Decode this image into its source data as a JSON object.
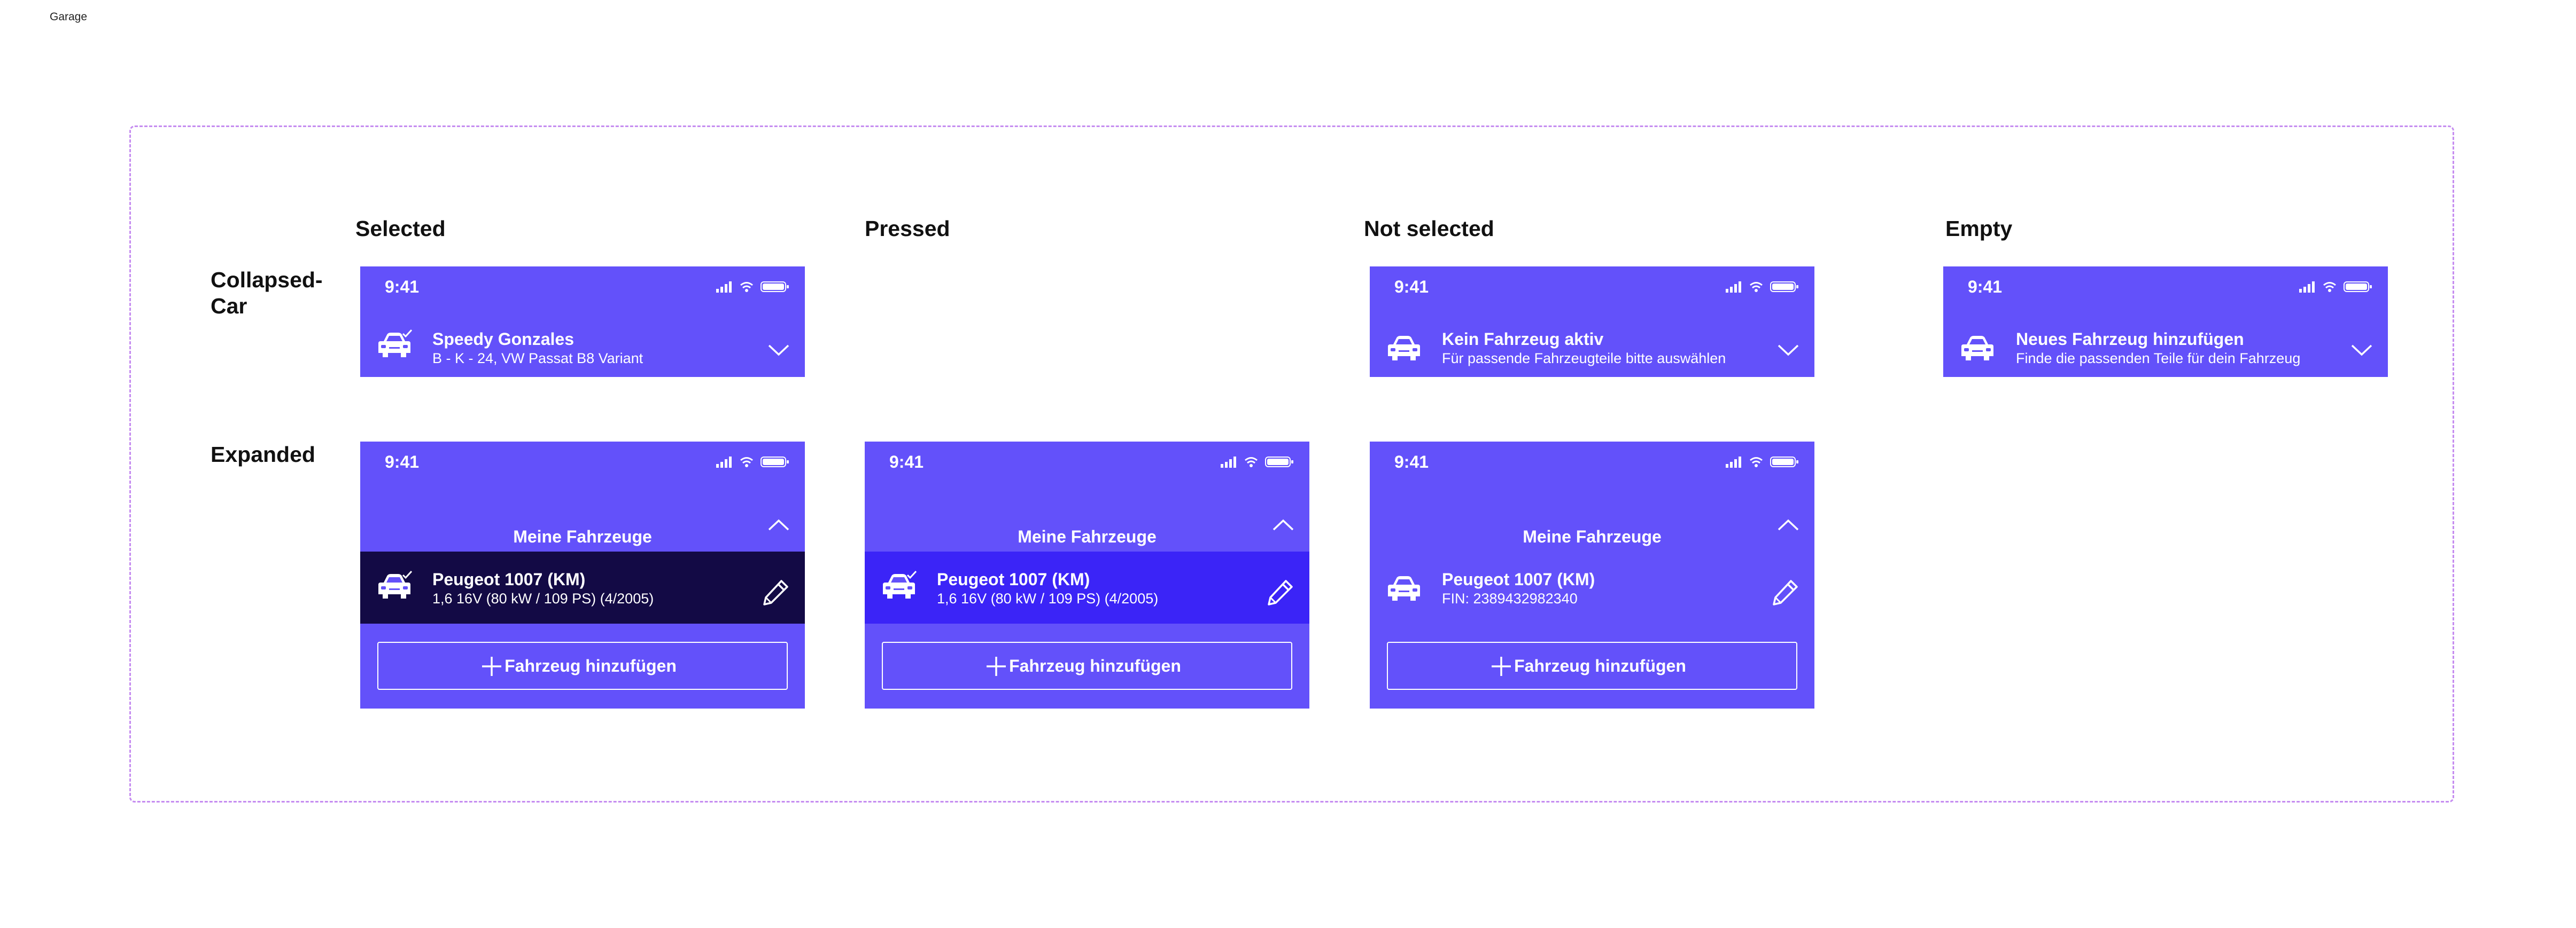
{
  "page": {
    "label": "Garage"
  },
  "columns": [
    "Selected",
    "Pressed",
    "Not selected",
    "Empty"
  ],
  "rows": [
    "Collapsed-Car",
    "Expanded"
  ],
  "status_bar": {
    "time": "9:41",
    "icons": [
      "signal-icon",
      "wifi-icon",
      "battery-icon"
    ]
  },
  "collapsed": {
    "selected": {
      "title": "Speedy Gonzales",
      "subtitle": "B - K - 24, VW Passat B8 Variant",
      "icon": "car-check-icon"
    },
    "not_selected": {
      "title": "Kein Fahrzeug aktiv",
      "subtitle": "Für passende Fahrzeugteile bitte auswählen",
      "icon": "car-icon"
    },
    "empty": {
      "title": "Neues Fahrzeug hinzufügen",
      "subtitle": "Finde die passenden Teile für dein Fahrzeug",
      "icon": "car-icon"
    }
  },
  "expanded": {
    "header_title": "Meine Fahrzeuge",
    "add_button_label": "Fahrzeug hinzufügen",
    "selected": {
      "title": "Peugeot 1007 (KM)",
      "subtitle": "1,6 16V (80 kW / 109 PS) (4/2005)",
      "icon": "car-check-icon"
    },
    "pressed": {
      "title": "Peugeot 1007 (KM)",
      "subtitle": "1,6 16V (80 kW / 109 PS) (4/2005)",
      "icon": "car-check-icon"
    },
    "not_selected": {
      "title": "Peugeot 1007 (KM)",
      "subtitle": "FIN: 2389432982340",
      "icon": "car-icon"
    }
  },
  "colors": {
    "card": "#6351fa",
    "selected_row": "#130a45",
    "pressed_row": "#3b24f7",
    "frame_border": "#c58cf0"
  }
}
